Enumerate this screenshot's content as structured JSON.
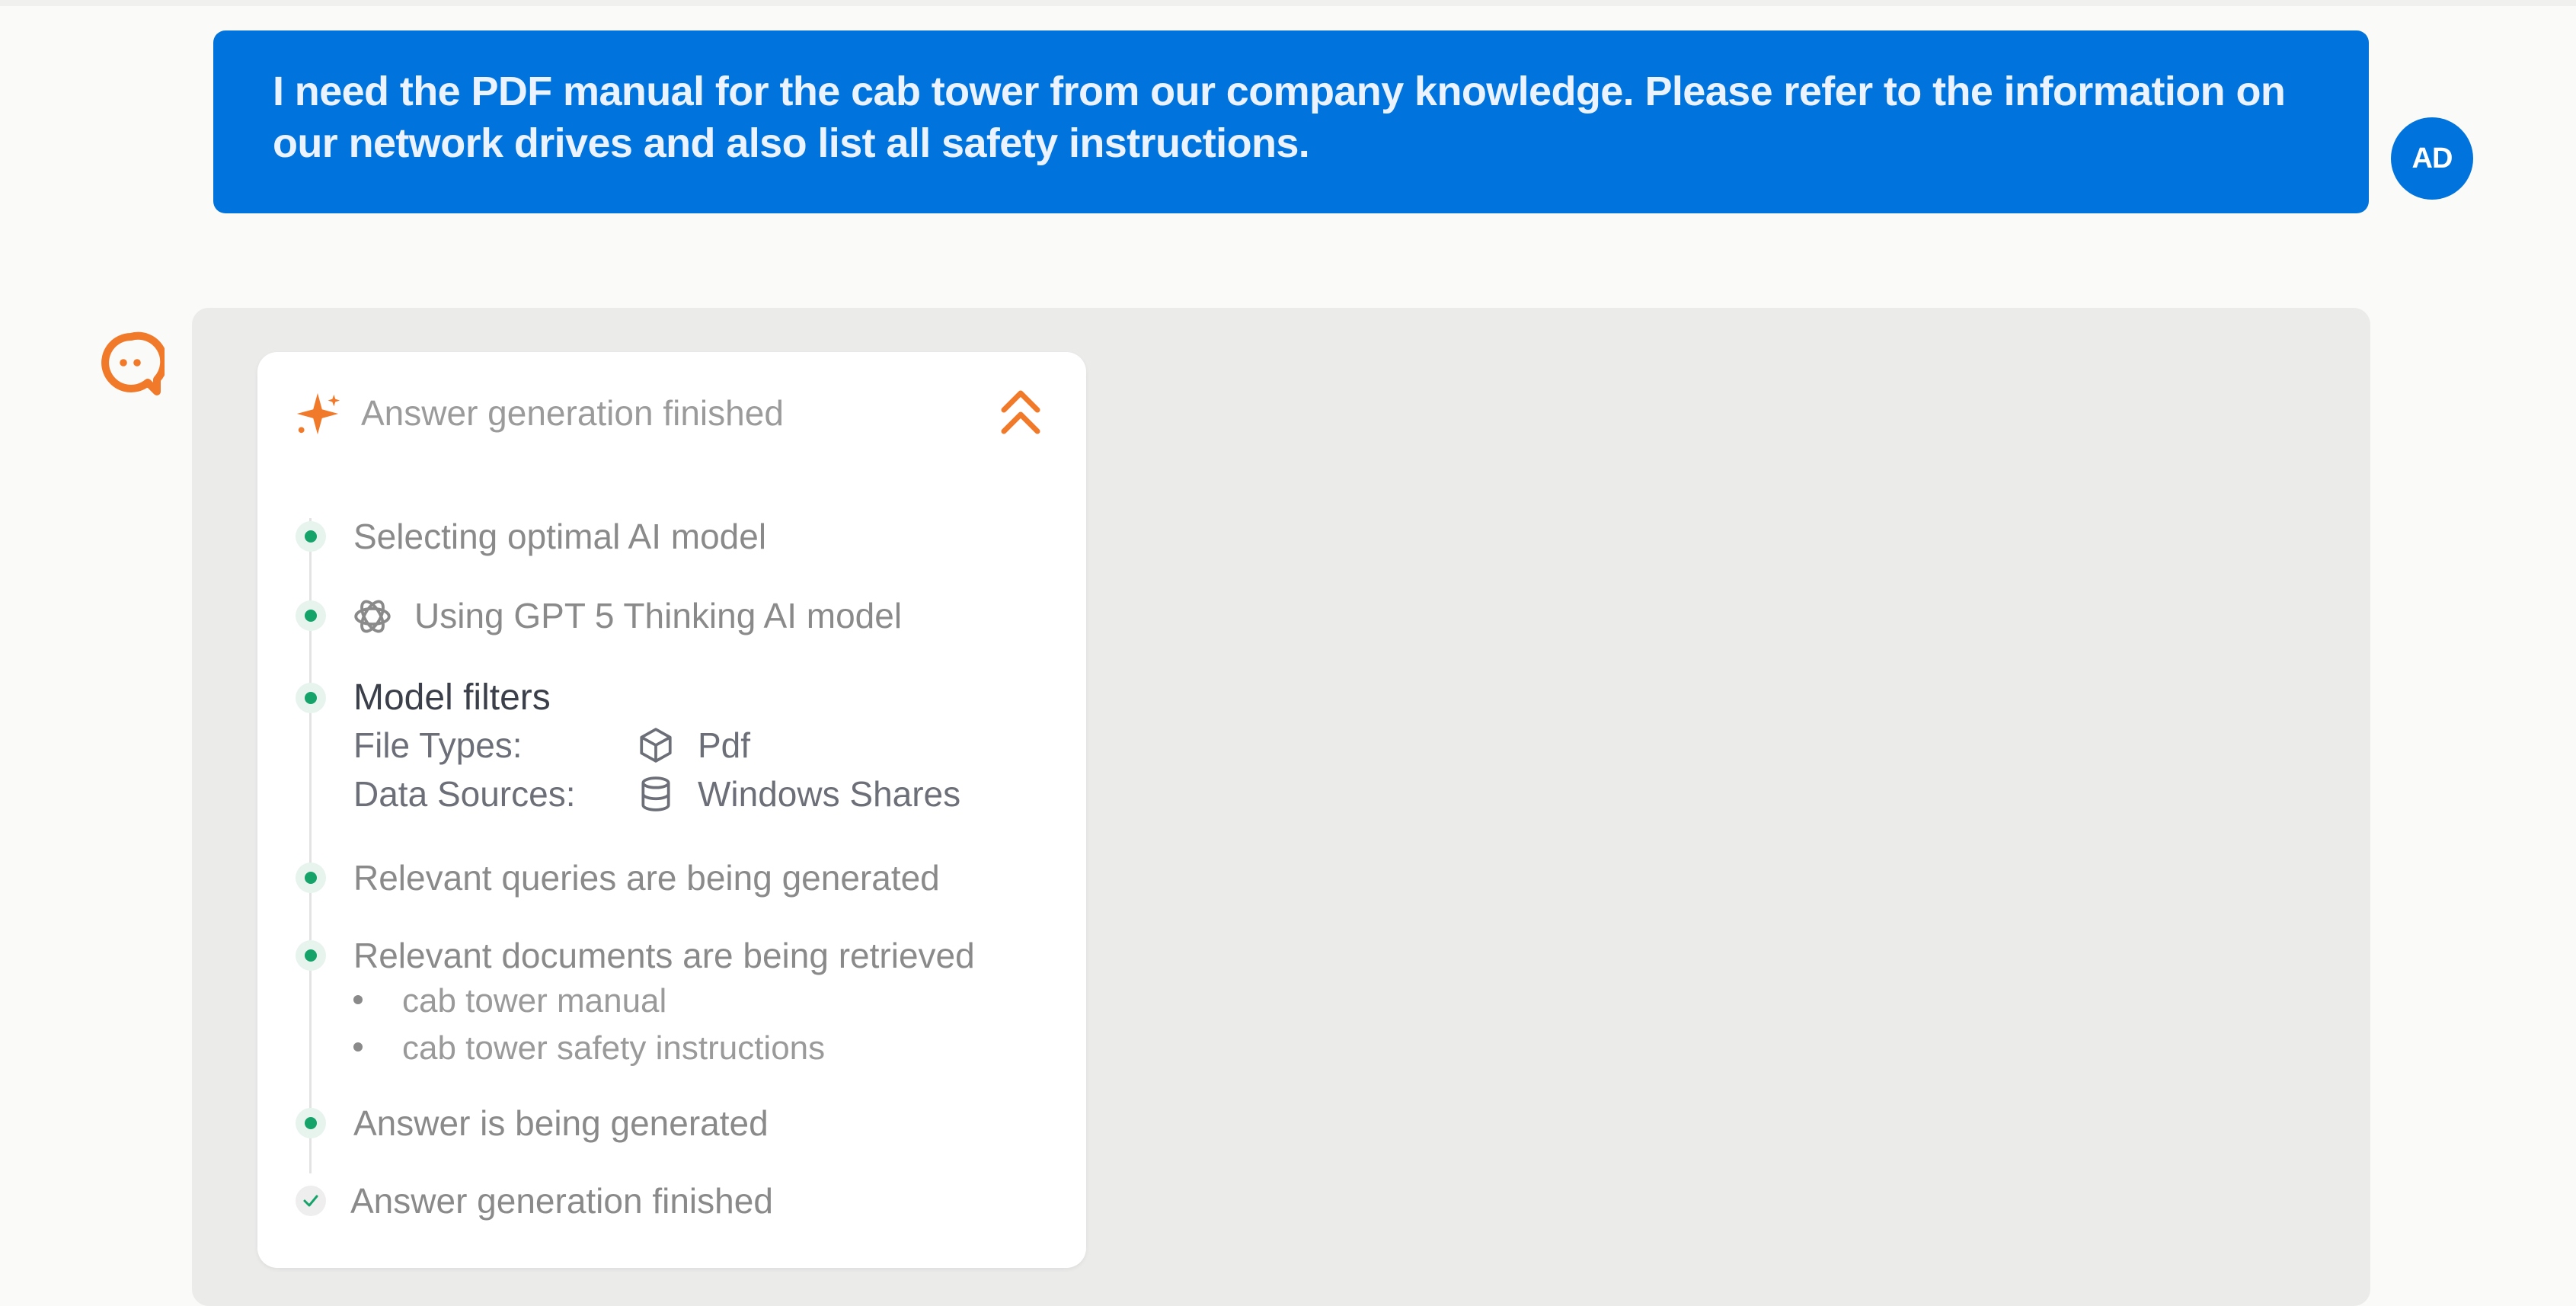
{
  "user_message": {
    "text": "I need the PDF manual for the cab tower from our company knowledge. Please refer to the information on our network drives and also list all safety instructions.",
    "avatar_initials": "AD"
  },
  "assistant": {
    "logo_icon": "chat-bubble-logo-icon",
    "progress": {
      "header_title": "Answer generation finished",
      "header_icon": "sparkle-icon",
      "collapse_icon": "chevrons-up-icon",
      "steps": [
        {
          "label": "Selecting optimal AI model",
          "status": "done"
        },
        {
          "label": "Using GPT 5 Thinking AI model",
          "icon": "openai-icon",
          "status": "done"
        },
        {
          "label": "Model filters",
          "status": "done"
        },
        {
          "label": "Relevant queries are being generated",
          "status": "done"
        },
        {
          "label": "Relevant documents are being retrieved",
          "status": "done"
        },
        {
          "label": "Answer is being generated",
          "status": "done"
        },
        {
          "label": "Answer generation finished",
          "status": "check"
        }
      ],
      "filters": {
        "file_types_label": "File Types:",
        "file_types_value": "Pdf",
        "file_types_icon": "cube-icon",
        "data_sources_label": "Data Sources:",
        "data_sources_value": "Windows Shares",
        "data_sources_icon": "database-icon"
      },
      "documents": [
        "cab tower manual",
        "cab tower safety instructions"
      ]
    }
  },
  "colors": {
    "user_bubble": "#0073dc",
    "accent_orange": "#f07a2a",
    "status_green": "#16a36a"
  }
}
